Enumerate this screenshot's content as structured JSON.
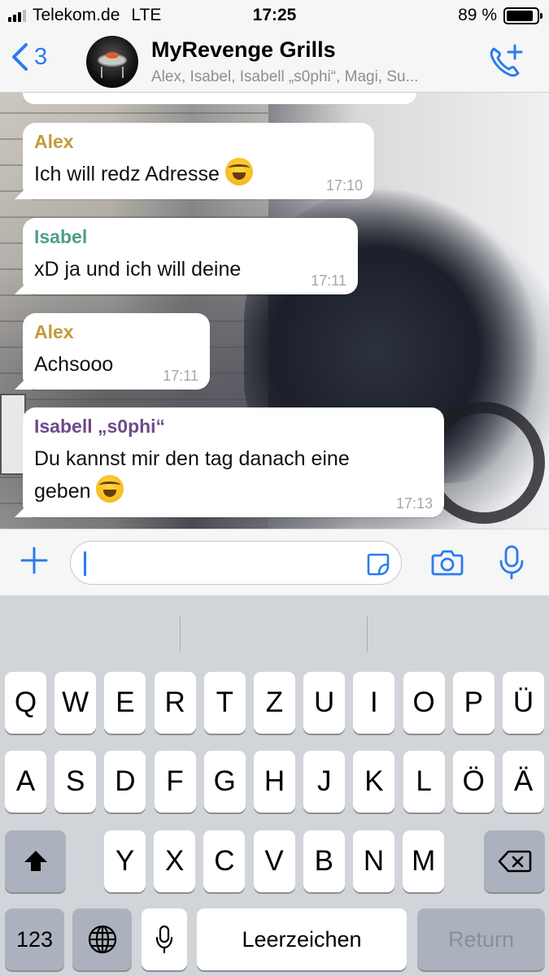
{
  "status_bar": {
    "carrier": "Telekom.de",
    "network": "LTE",
    "time": "17:25",
    "battery": "89 %",
    "battery_level": 0.89
  },
  "header": {
    "back_count": "3",
    "title": "MyRevenge Grills",
    "subtitle": "Alex, Isabel, Isabell „s0phi“, Magi, Su..."
  },
  "messages": [
    {
      "sender": "Alex",
      "sender_color": "#c39a3a",
      "text": "Ich will redz Adresse",
      "emoji": true,
      "time": "17:10"
    },
    {
      "sender": "Isabel",
      "sender_color": "#4f9d8c",
      "text": "xD ja und ich will deine",
      "emoji": false,
      "time": "17:11"
    },
    {
      "sender": "Alex",
      "sender_color": "#c39a3a",
      "text": "Achsooo",
      "emoji": false,
      "time": "17:11"
    },
    {
      "sender": "Isabell „s0phi“",
      "sender_color": "#6e4a8a",
      "text_line1": "Du kannst mir den tag danach eine",
      "text_line2": "geben",
      "emoji": true,
      "time": "17:13"
    }
  ],
  "input": {
    "placeholder": ""
  },
  "keyboard": {
    "row1": [
      "Q",
      "W",
      "E",
      "R",
      "T",
      "Z",
      "U",
      "I",
      "O",
      "P",
      "Ü"
    ],
    "row2": [
      "A",
      "S",
      "D",
      "F",
      "G",
      "H",
      "J",
      "K",
      "L",
      "Ö",
      "Ä"
    ],
    "row3": [
      "Y",
      "X",
      "C",
      "V",
      "B",
      "N",
      "M"
    ],
    "numbers_key": "123",
    "space_key": "Leerzeichen",
    "return_key": "Return"
  },
  "colors": {
    "accent": "#2a7bef",
    "bubble": "#ffffff",
    "time_text": "#a6a6a6"
  }
}
